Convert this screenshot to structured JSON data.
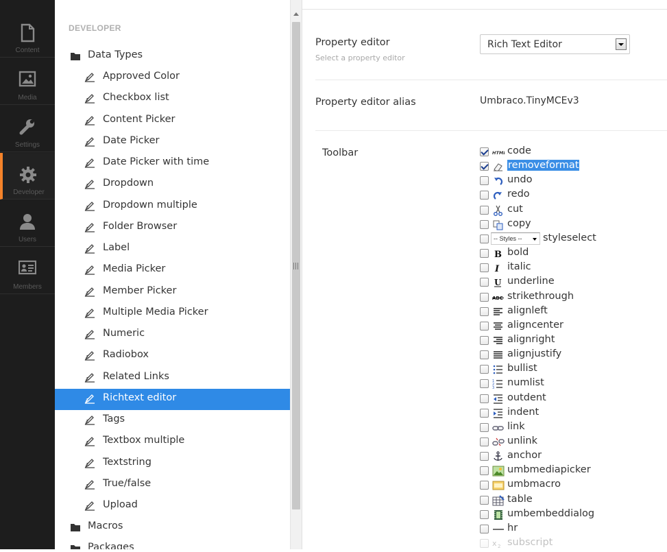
{
  "app_sections": [
    {
      "key": "content",
      "label": "Content",
      "icon": "document-icon",
      "active": false
    },
    {
      "key": "media",
      "label": "Media",
      "icon": "image-icon",
      "active": false
    },
    {
      "key": "settings",
      "label": "Settings",
      "icon": "wrench-icon",
      "active": false
    },
    {
      "key": "developer",
      "label": "Developer",
      "icon": "gear-icon",
      "active": true
    },
    {
      "key": "users",
      "label": "Users",
      "icon": "user-icon",
      "active": false
    },
    {
      "key": "members",
      "label": "Members",
      "icon": "id-card-icon",
      "active": false
    }
  ],
  "tree": {
    "heading": "DEVELOPER",
    "data_types_label": "Data Types",
    "items": [
      "Approved Color",
      "Checkbox list",
      "Content Picker",
      "Date Picker",
      "Date Picker with time",
      "Dropdown",
      "Dropdown multiple",
      "Folder Browser",
      "Label",
      "Media Picker",
      "Member Picker",
      "Multiple Media Picker",
      "Numeric",
      "Radiobox",
      "Related Links",
      "Richtext editor",
      "Tags",
      "Textbox multiple",
      "Textstring",
      "True/false",
      "Upload"
    ],
    "selected_item": "Richtext editor",
    "macros_label": "Macros",
    "packages_label": "Packages"
  },
  "editor": {
    "property_editor_label": "Property editor",
    "property_editor_desc": "Select a property editor",
    "property_editor_value": "Rich Text Editor",
    "alias_label": "Property editor alias",
    "alias_value": "Umbraco.TinyMCEv3",
    "toolbar_label": "Toolbar",
    "styles_dropdown_text": "-- Styles --",
    "toolbar_items": [
      {
        "name": "code",
        "icon": "html-icon",
        "checked": true
      },
      {
        "name": "removeformat",
        "icon": "eraser-icon",
        "checked": true,
        "highlighted": true
      },
      {
        "name": "undo",
        "icon": "undo-icon",
        "checked": false
      },
      {
        "name": "redo",
        "icon": "redo-icon",
        "checked": false
      },
      {
        "name": "cut",
        "icon": "scissors-icon",
        "checked": false
      },
      {
        "name": "copy",
        "icon": "copy-icon",
        "checked": false
      },
      {
        "name": "styleselect",
        "icon": "styles-dropdown",
        "checked": false
      },
      {
        "name": "bold",
        "icon": "bold-icon",
        "checked": false
      },
      {
        "name": "italic",
        "icon": "italic-icon",
        "checked": false
      },
      {
        "name": "underline",
        "icon": "underline-icon",
        "checked": false
      },
      {
        "name": "strikethrough",
        "icon": "strikethrough-icon",
        "checked": false
      },
      {
        "name": "alignleft",
        "icon": "align-left-icon",
        "checked": false
      },
      {
        "name": "aligncenter",
        "icon": "align-center-icon",
        "checked": false
      },
      {
        "name": "alignright",
        "icon": "align-right-icon",
        "checked": false
      },
      {
        "name": "alignjustify",
        "icon": "align-justify-icon",
        "checked": false
      },
      {
        "name": "bullist",
        "icon": "bullet-list-icon",
        "checked": false
      },
      {
        "name": "numlist",
        "icon": "numbered-list-icon",
        "checked": false
      },
      {
        "name": "outdent",
        "icon": "outdent-icon",
        "checked": false
      },
      {
        "name": "indent",
        "icon": "indent-icon",
        "checked": false
      },
      {
        "name": "link",
        "icon": "link-icon",
        "checked": false
      },
      {
        "name": "unlink",
        "icon": "unlink-icon",
        "checked": false
      },
      {
        "name": "anchor",
        "icon": "anchor-icon",
        "checked": false
      },
      {
        "name": "umbmediapicker",
        "icon": "media-picker-icon",
        "checked": false
      },
      {
        "name": "umbmacro",
        "icon": "macro-icon",
        "checked": false
      },
      {
        "name": "table",
        "icon": "table-icon",
        "checked": false
      },
      {
        "name": "umbembeddialog",
        "icon": "embed-icon",
        "checked": false
      },
      {
        "name": "hr",
        "icon": "hr-icon",
        "checked": false
      },
      {
        "name": "subscript",
        "icon": "subscript-icon",
        "checked": false
      }
    ]
  },
  "colors": {
    "selected": "#2f8ae6",
    "accent": "#f5832a",
    "appbar": "#1d1d1d"
  }
}
